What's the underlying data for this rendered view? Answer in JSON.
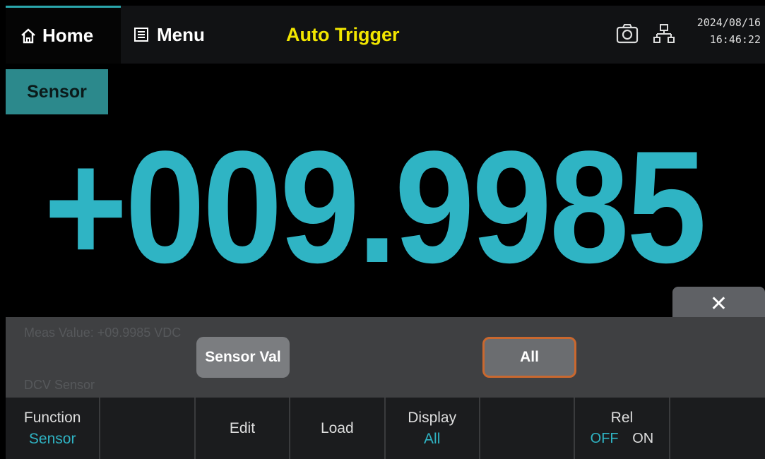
{
  "header": {
    "home_label": "Home",
    "menu_label": "Menu",
    "title": "Auto Trigger",
    "date": "2024/08/16",
    "time": "16:46:22",
    "icons": [
      "home-icon",
      "menu-icon",
      "camera-icon",
      "network-icon"
    ]
  },
  "function_tag": "Sensor",
  "reading": "+009.9985",
  "popup": {
    "close_label": "✕",
    "ghost_line1": "Meas Value: +09.9985 VDC",
    "ghost_line2": "DCV Sensor",
    "options": [
      "Sensor Val",
      "All"
    ],
    "selected": "All"
  },
  "softkeys": [
    {
      "label": "Function",
      "value": "Sensor"
    },
    {
      "label": "",
      "value": ""
    },
    {
      "label": "Edit",
      "value": ""
    },
    {
      "label": "Load",
      "value": ""
    },
    {
      "label": "Display",
      "value": "All"
    },
    {
      "label": "",
      "value": ""
    },
    {
      "label": "Rel",
      "off": "OFF",
      "on": "ON"
    },
    {
      "label": "",
      "value": ""
    }
  ],
  "colors": {
    "accent": "#2fb4c4",
    "title_yellow": "#f2e600",
    "selected_border": "#c9682f"
  }
}
